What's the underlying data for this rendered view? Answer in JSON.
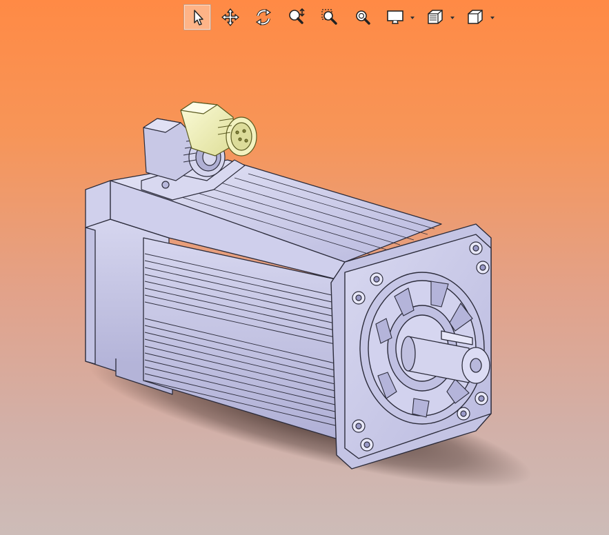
{
  "app": {
    "view": "3d-model-viewport"
  },
  "toolbar": {
    "items": [
      {
        "id": "select",
        "icon": "select-arrow-icon",
        "active": true
      },
      {
        "id": "pan",
        "icon": "pan-move-icon",
        "active": false
      },
      {
        "id": "rotate",
        "icon": "rotate-icon",
        "active": false
      },
      {
        "id": "zoom-in-out",
        "icon": "zoom-in-out-icon",
        "active": false
      },
      {
        "id": "zoom-area",
        "icon": "zoom-area-icon",
        "active": false
      },
      {
        "id": "zoom-fit",
        "icon": "zoom-fit-icon",
        "active": false
      },
      {
        "id": "display-mode",
        "icon": "display-monitor-icon",
        "dropdown": true
      },
      {
        "id": "section-view",
        "icon": "section-view-icon",
        "dropdown": true
      },
      {
        "id": "standard-views",
        "icon": "cube-view-icon",
        "dropdown": true
      }
    ]
  },
  "colors": {
    "background_top": "#ff8a45",
    "background_bottom": "#cdbcb8",
    "model_body": "#c9c9e8",
    "model_edge": "#2b2b3a",
    "connector_highlight": "#f0f0b0",
    "toolbar_active_border": "#c89a80"
  }
}
